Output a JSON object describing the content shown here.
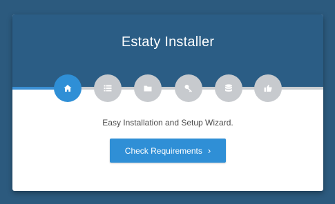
{
  "installer": {
    "title": "Estaty Installer",
    "subtitle": "Easy Installation and Setup Wizard.",
    "primary_button": {
      "label": "Check Requirements",
      "icon": "chevron-right-icon"
    },
    "progress": 0.22
  },
  "steps": [
    {
      "icon": "home-icon",
      "active": true
    },
    {
      "icon": "list-icon",
      "active": false
    },
    {
      "icon": "folder-icon",
      "active": false
    },
    {
      "icon": "key-icon",
      "active": false
    },
    {
      "icon": "database-icon",
      "active": false
    },
    {
      "icon": "thumbs-up-icon",
      "active": false
    }
  ],
  "colors": {
    "background": "#2c5a7e",
    "header": "#2b5d85",
    "accent": "#2f8fd6",
    "inactive_step": "#c7cace"
  }
}
